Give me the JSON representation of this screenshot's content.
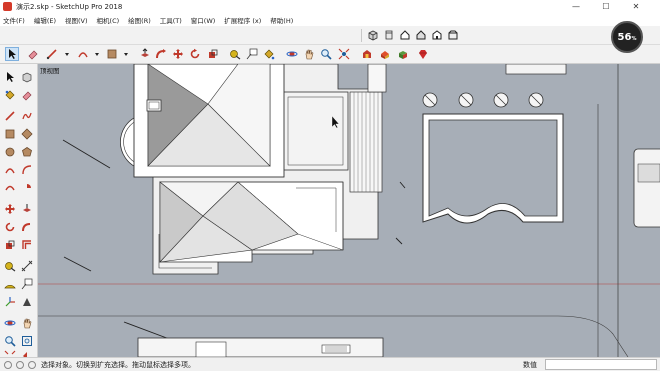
{
  "window": {
    "title": "演示2.skp - SketchUp Pro 2018",
    "minimize_glyph": "—",
    "maximize_glyph": "☐",
    "close_glyph": "✕"
  },
  "menu": [
    "文件(F)",
    "编辑(E)",
    "视图(V)",
    "相机(C)",
    "绘图(R)",
    "工具(T)",
    "窗口(W)",
    "扩展程序 (x)",
    "帮助(H)"
  ],
  "viewport": {
    "view_name": "顶视图",
    "background": "#a7aeb7"
  },
  "status": {
    "message": "选择对象。切换到扩充选择。拖动鼠标选择多项。",
    "measurements_label": "数值",
    "measurements_value": ""
  },
  "badge": {
    "value": "56",
    "unit": "%"
  },
  "icons": {
    "top_views": [
      "iso-view-icon",
      "top-view-icon",
      "front-view-icon",
      "right-view-icon",
      "back-view-icon",
      "left-view-icon"
    ],
    "main_toolbar": [
      "select-icon",
      "eraser-icon",
      "line-icon",
      "arc-icon",
      "shapes-icon",
      "push-pull-icon",
      "move-icon",
      "rotate-icon",
      "scale-icon",
      "offset-icon",
      "tape-measure-icon",
      "text-icon",
      "paint-bucket-icon",
      "orbit-icon",
      "pan-icon",
      "zoom-icon",
      "zoom-extents-icon",
      "warehouse-icon",
      "extension-warehouse-icon",
      "ruby-icon"
    ]
  }
}
